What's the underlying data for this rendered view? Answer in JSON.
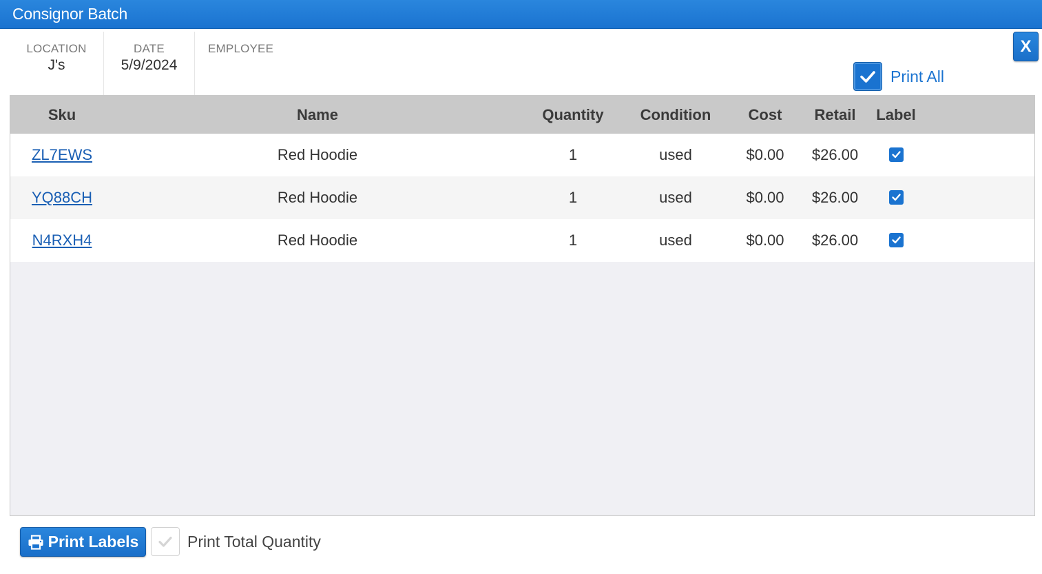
{
  "window": {
    "title": "Consignor Batch",
    "close_label": "X"
  },
  "info": {
    "location": {
      "label": "LOCATION",
      "value": "J's"
    },
    "date": {
      "label": "DATE",
      "value": "5/9/2024"
    },
    "employee": {
      "label": "EMPLOYEE",
      "value": ""
    }
  },
  "print_all": {
    "label": "Print All",
    "checked": true
  },
  "table": {
    "columns": [
      "Sku",
      "Name",
      "Quantity",
      "Condition",
      "Cost",
      "Retail",
      "Label"
    ],
    "rows": [
      {
        "sku": "ZL7EWS",
        "name": "Red Hoodie",
        "quantity": "1",
        "condition": "used",
        "cost": "$0.00",
        "retail": "$26.00",
        "label": true
      },
      {
        "sku": "YQ88CH",
        "name": "Red Hoodie",
        "quantity": "1",
        "condition": "used",
        "cost": "$0.00",
        "retail": "$26.00",
        "label": true
      },
      {
        "sku": "N4RXH4",
        "name": "Red Hoodie",
        "quantity": "1",
        "condition": "used",
        "cost": "$0.00",
        "retail": "$26.00",
        "label": true
      }
    ]
  },
  "footer": {
    "print_labels": "Print Labels",
    "print_total_quantity": {
      "label": "Print Total Quantity",
      "checked": false
    }
  },
  "icons": {
    "close": "close-icon",
    "print_all_check": "check-icon",
    "printer": "printer-icon",
    "label_check": "check-icon"
  },
  "colors": {
    "accent": "#1a73d0",
    "link": "#1a5fb4",
    "header_bg": "#c9c9c9",
    "grid_bg": "#f0f0f4"
  }
}
